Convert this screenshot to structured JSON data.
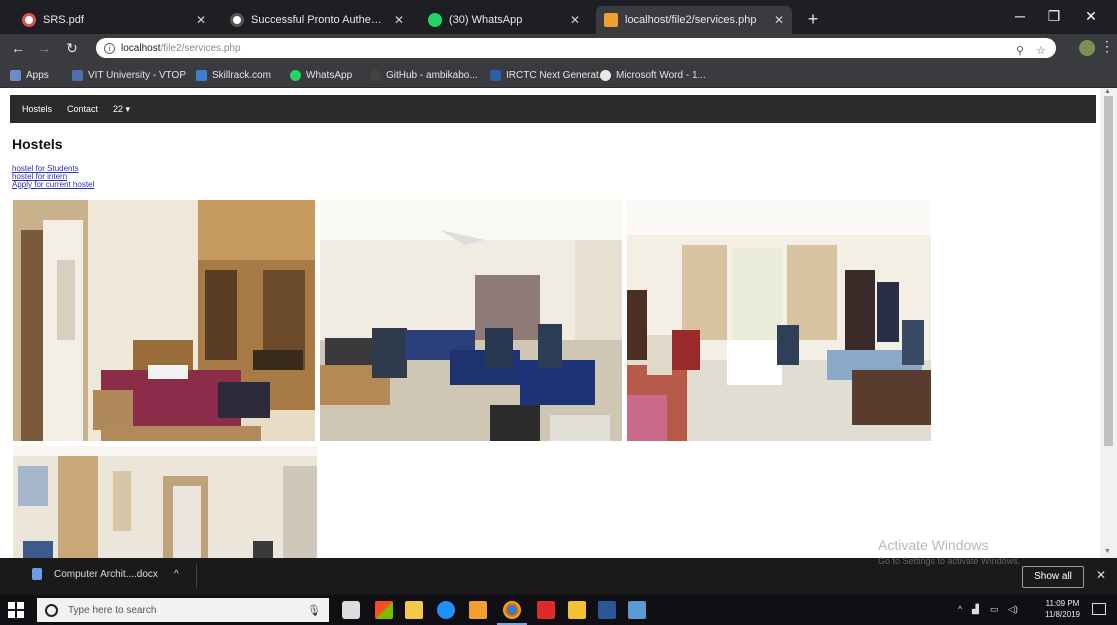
{
  "browser": {
    "tabs": [
      {
        "title": "SRS.pdf",
        "color": "#d9534f",
        "active": false
      },
      {
        "title": "Successful Pronto Authentication",
        "color": "#4caf50",
        "active": false
      },
      {
        "title": "(30) WhatsApp",
        "color": "#25d366",
        "active": false
      },
      {
        "title": "localhost/file2/services.php",
        "color": "#f0a030",
        "active": true
      }
    ],
    "url_host": "localhost",
    "url_path": "/file2/services.php",
    "bookmarks": [
      {
        "label": "Apps",
        "color": "#6b8cc7"
      },
      {
        "label": "VIT University - VTOP",
        "color": "#4a6fb5"
      },
      {
        "label": "Skillrack.com",
        "color": "#3a7fd0"
      },
      {
        "label": "WhatsApp",
        "color": "#25d366"
      },
      {
        "label": "GitHub - ambikabo...",
        "color": "#cccccc"
      },
      {
        "label": "IRCTC Next Generat...",
        "color": "#2d5fa8"
      },
      {
        "label": "Microsoft Word - 1...",
        "color": "#e8e8e8"
      }
    ]
  },
  "site": {
    "nav": [
      "Hostels",
      "Contact",
      "22 ▾"
    ],
    "heading": "Hostels",
    "links": [
      "hostel for Students",
      "hostel for intern",
      "Apply for current hostel"
    ]
  },
  "downloads": {
    "item": "Computer Archit....docx",
    "show_all": "Show all"
  },
  "watermark": {
    "title": "Activate Windows",
    "subtitle": "Go to Settings to activate Windows."
  },
  "taskbar": {
    "search_placeholder": "Type here to search",
    "time": "11:09 PM",
    "date": "11/8/2019"
  }
}
